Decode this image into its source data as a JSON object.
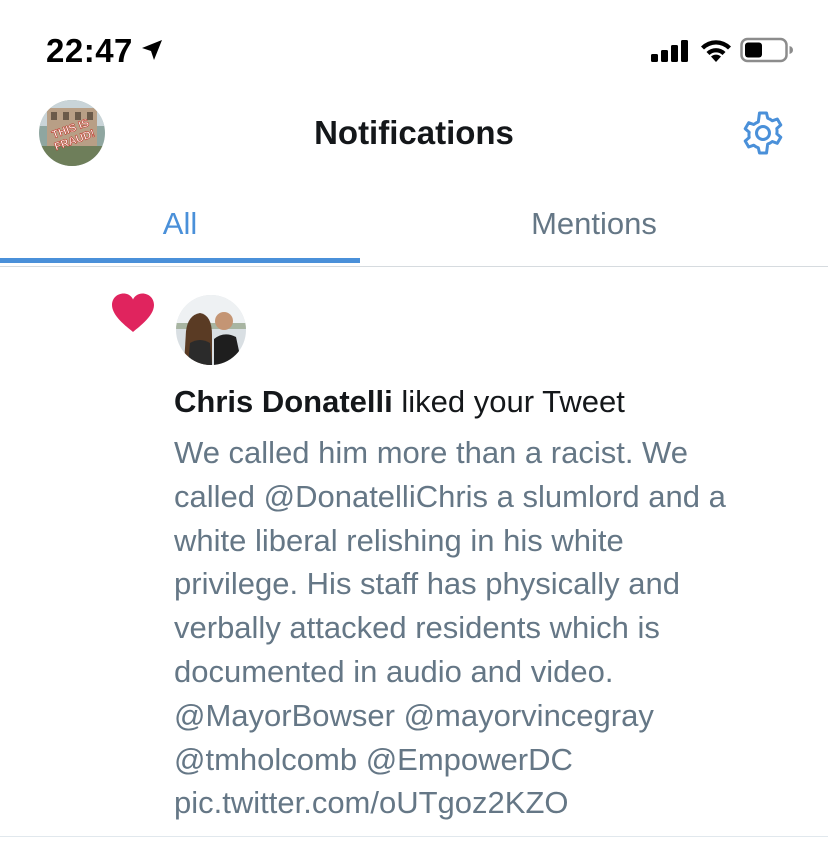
{
  "status_bar": {
    "time": "22:47",
    "icons": [
      "location-arrow-icon",
      "cellular-signal-icon",
      "wifi-icon",
      "battery-icon"
    ]
  },
  "header": {
    "title": "Notifications",
    "avatar_text": "THIS IS FRAUD!",
    "settings_icon": "gear-icon"
  },
  "tabs": [
    {
      "label": "All",
      "active": true
    },
    {
      "label": "Mentions",
      "active": false
    }
  ],
  "notification": {
    "type_icon": "heart-icon",
    "user_name": "Chris Donatelli",
    "action_text": " liked your Tweet",
    "tweet_lines": [
      "We called him more than a racist. We",
      "called @DonatelliChris a slumlord and a",
      "white liberal relishing in his white",
      "privilege. His staff has physically and",
      "verbally attacked residents which is",
      "documented in audio and video.",
      "@MayorBowser @mayorvincegray",
      "@tmholcomb @EmpowerDC",
      "pic.twitter.com/oUTgoz2KZO"
    ]
  },
  "colors": {
    "accent": "#4a90d9",
    "heart": "#e0245e",
    "secondary_text": "#657786"
  }
}
